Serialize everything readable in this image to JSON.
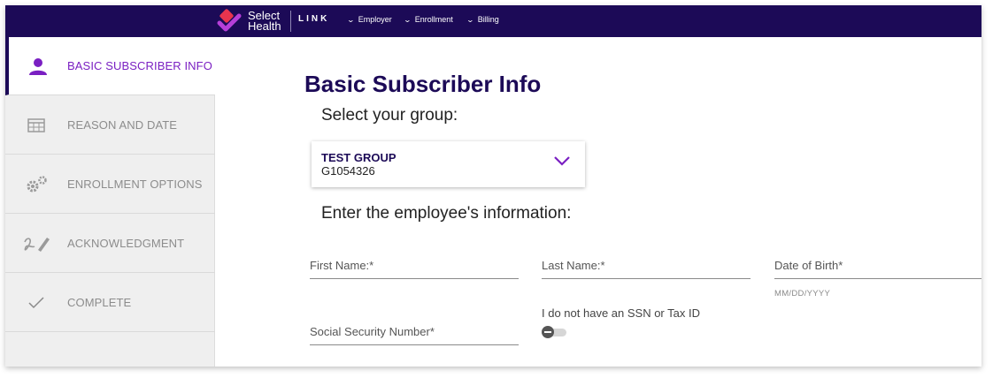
{
  "brand": {
    "name_line1": "Select",
    "name_line2": "Health",
    "product": "LINK"
  },
  "top_nav": [
    {
      "label": "Employer",
      "icon": "chevron-down-icon"
    },
    {
      "label": "Enrollment",
      "icon": "chevron-down-icon"
    },
    {
      "label": "Billing",
      "icon": "chevron-down-icon"
    }
  ],
  "sidebar": {
    "items": [
      {
        "label": "BASIC SUBSCRIBER INFO",
        "icon": "person-icon",
        "active": true
      },
      {
        "label": "REASON AND DATE",
        "icon": "calendar-icon",
        "active": false
      },
      {
        "label": "ENROLLMENT OPTIONS",
        "icon": "gears-icon",
        "active": false
      },
      {
        "label": "ACKNOWLEDGMENT",
        "icon": "signature-icon",
        "active": false
      },
      {
        "label": "COMPLETE",
        "icon": "checkmark-icon",
        "active": false
      }
    ]
  },
  "main": {
    "title": "Basic Subscriber Info",
    "group_prompt": "Select your group:",
    "group": {
      "name": "TEST GROUP",
      "id": "G1054326"
    },
    "employee_prompt": "Enter the employee's information:",
    "fields": {
      "first_name": {
        "label": "First Name:*",
        "value": ""
      },
      "last_name": {
        "label": "Last Name:*",
        "value": ""
      },
      "dob": {
        "label": "Date of Birth*",
        "hint": "MM/DD/YYYY",
        "value": ""
      },
      "ssn": {
        "label": "Social Security Number*",
        "value": ""
      }
    },
    "no_ssn_toggle": {
      "label": "I do not have an SSN or Tax ID",
      "on": false
    }
  },
  "colors": {
    "brand_navy": "#1c0a57",
    "accent_purple": "#7a1fc2",
    "logo_red": "#e8344e",
    "sidebar_bg": "#efefef"
  }
}
